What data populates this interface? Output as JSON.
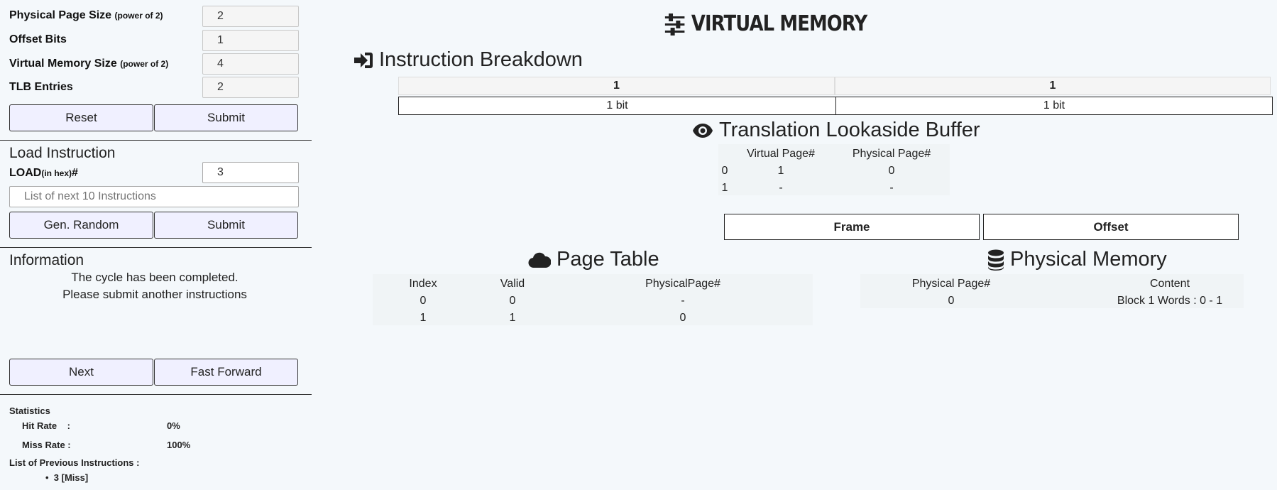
{
  "config": {
    "physical_page_size": {
      "label": "Physical Page Size",
      "hint": "(power of 2)",
      "value": "2"
    },
    "offset_bits": {
      "label": "Offset Bits",
      "value": "1"
    },
    "virtual_memory_size": {
      "label": "Virtual Memory Size",
      "hint": "(power of 2)",
      "value": "4"
    },
    "tlb_entries": {
      "label": "TLB Entries",
      "value": "2"
    },
    "reset_label": "Reset",
    "submit_label": "Submit"
  },
  "load": {
    "title": "Load Instruction",
    "label": "LOAD",
    "hint": "(in hex)",
    "hash": "#",
    "value": "3",
    "list_placeholder": "List of next 10 Instructions",
    "random_label": "Gen. Random",
    "submit_label": "Submit"
  },
  "information": {
    "title": "Information",
    "line1": "The cycle has been completed.",
    "line2": "Please submit another instructions",
    "next_label": "Next",
    "fast_forward_label": "Fast Forward"
  },
  "statistics": {
    "title": "Statistics",
    "hit_label": "Hit Rate",
    "hit_colon": ":",
    "hit_value": "0%",
    "miss_label": "Miss Rate :",
    "miss_value": "100%",
    "previous_title": "List of Previous Instructions :",
    "previous": [
      "3 [Miss]"
    ]
  },
  "header": {
    "title": "VIRTUAL MEMORY",
    "icon": "sliders-icon"
  },
  "breakdown": {
    "title": "Instruction Breakdown",
    "icon": "sign-in-icon",
    "bits": [
      "1",
      "1"
    ],
    "sizes": [
      "1 bit",
      "1 bit"
    ]
  },
  "tlb": {
    "title": "Translation Lookaside Buffer",
    "icon": "eye-icon",
    "headers": [
      "Virtual Page#",
      "Physical Page#"
    ],
    "rows": [
      {
        "index": "0",
        "virtual": "1",
        "physical": "0"
      },
      {
        "index": "1",
        "virtual": "-",
        "physical": "-"
      }
    ]
  },
  "address": {
    "frame_label": "Frame",
    "offset_label": "Offset"
  },
  "page_table": {
    "title": "Page Table",
    "icon": "cloud-icon",
    "headers": [
      "Index",
      "Valid",
      "PhysicalPage#"
    ],
    "rows": [
      {
        "index": "0",
        "valid": "0",
        "physical": "-"
      },
      {
        "index": "1",
        "valid": "1",
        "physical": "0"
      }
    ]
  },
  "physical_memory": {
    "title": "Physical Memory",
    "icon": "database-icon",
    "headers": [
      "Physical Page#",
      "Content"
    ],
    "rows": [
      {
        "page": "0",
        "content": "Block 1 Words : 0 - 1"
      }
    ]
  }
}
